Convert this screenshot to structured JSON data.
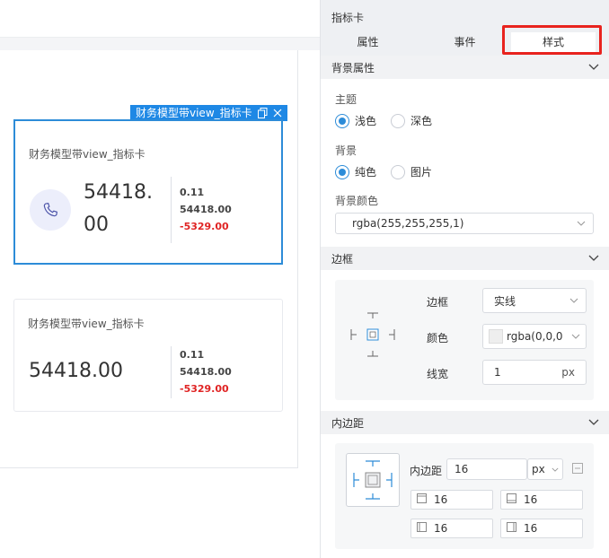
{
  "canvas": {
    "selected_tag": "财务模型带view_指标卡",
    "cards": [
      {
        "title": "财务模型带view_指标卡",
        "main_value": "54418.00",
        "sub_values": [
          "0.11",
          "54418.00",
          "-5329.00"
        ],
        "has_icon": true,
        "icon": "phone-icon"
      },
      {
        "title": "财务模型带view_指标卡",
        "main_value": "54418.00",
        "sub_values": [
          "0.11",
          "54418.00",
          "-5329.00"
        ],
        "has_icon": false
      }
    ]
  },
  "panel": {
    "title": "指标卡",
    "tabs": [
      "属性",
      "事件",
      "样式"
    ],
    "active_tab": "样式",
    "background_section": {
      "title": "背景属性",
      "theme_label": "主题",
      "theme_options": [
        "浅色",
        "深色"
      ],
      "theme_selected": "浅色",
      "bg_label": "背景",
      "bg_options": [
        "纯色",
        "图片"
      ],
      "bg_selected": "纯色",
      "bg_color_label": "背景颜色",
      "bg_color_value": "rgba(255,255,255,1)"
    },
    "border_section": {
      "title": "边框",
      "style_label": "边框",
      "style_value": "实线",
      "color_label": "颜色",
      "color_value": "rgba(0,0,0",
      "width_label": "线宽",
      "width_value": "1",
      "width_unit": "px"
    },
    "padding_section": {
      "title": "内边距",
      "label": "内边距",
      "value": "16",
      "unit": "px",
      "top": "16",
      "bottom": "16",
      "left": "16",
      "right": "16"
    }
  },
  "colors": {
    "accent": "#2d8cd8",
    "negative": "#e02424",
    "highlight": "#e8231e"
  }
}
